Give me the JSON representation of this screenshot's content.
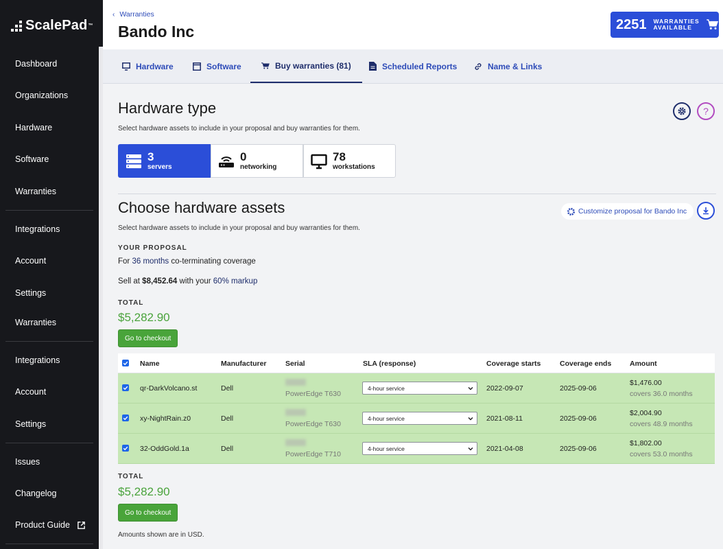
{
  "sidebar": {
    "logo": "ScalePad",
    "logo_tm": "™",
    "items": [
      {
        "label": "Dashboard"
      },
      {
        "label": "Organizations"
      },
      {
        "label": "Hardware"
      },
      {
        "label": "Software"
      },
      {
        "label": "Warranties"
      },
      {
        "label": "Integrations"
      },
      {
        "label": "Account"
      },
      {
        "label": "Settings"
      },
      {
        "label": "Warranties"
      },
      {
        "label": "Integrations"
      },
      {
        "label": "Account"
      },
      {
        "label": "Settings"
      },
      {
        "label": "Issues"
      },
      {
        "label": "Changelog"
      },
      {
        "label": "Product Guide"
      }
    ]
  },
  "header": {
    "breadcrumb": "Warranties",
    "title": "Bando Inc",
    "warranties_count": "2251",
    "warranties_label_1": "WARRANTIES",
    "warranties_label_2": "AVAILABLE"
  },
  "tabs": [
    {
      "label": "Hardware",
      "icon": "monitor-icon"
    },
    {
      "label": "Software",
      "icon": "window-icon"
    },
    {
      "label": "Buy warranties (81)",
      "icon": "cart-icon",
      "active": true
    },
    {
      "label": "Scheduled Reports",
      "icon": "document-icon"
    },
    {
      "label": "Name & Links",
      "icon": "link-icon"
    }
  ],
  "hardware_type": {
    "title": "Hardware type",
    "subtitle": "Select hardware assets to include in your proposal and buy warranties for them.",
    "cards": [
      {
        "count": "3",
        "label": "servers",
        "icon": "server-icon",
        "active": true
      },
      {
        "count": "0",
        "label": "networking",
        "icon": "router-icon"
      },
      {
        "count": "78",
        "label": "workstations",
        "icon": "monitor-icon"
      }
    ]
  },
  "assets": {
    "title": "Choose hardware assets",
    "subtitle": "Select hardware assets to include in your proposal and buy warranties for them.",
    "customize_label": "Customize proposal for Bando Inc",
    "proposal_label": "YOUR PROPOSAL",
    "coverage_prefix": "For",
    "coverage_months": "36 months",
    "coverage_mode": "co-terminating",
    "coverage_suffix": "coverage",
    "sell_prefix": "Sell at",
    "sell_amount": "$8,452.64",
    "sell_middle": "with your",
    "markup": "60% markup",
    "total_label": "TOTAL",
    "total_amount": "$5,282.90",
    "checkout_label": "Go to checkout",
    "footnote": "Amounts shown are in USD."
  },
  "table": {
    "headers": [
      "Name",
      "Manufacturer",
      "Serial",
      "SLA (response)",
      "Coverage starts",
      "Coverage ends",
      "Amount"
    ],
    "rows": [
      {
        "name": "qr-DarkVolcano.st",
        "manufacturer": "Dell",
        "model": "PowerEdge T630",
        "sla": "4-hour service",
        "start": "2022-09-07",
        "end": "2025-09-06",
        "amount": "$1,476.00",
        "covers": "covers 36.0 months"
      },
      {
        "name": "xy-NightRain.z0",
        "manufacturer": "Dell",
        "model": "PowerEdge T630",
        "sla": "4-hour service",
        "start": "2021-08-11",
        "end": "2025-09-06",
        "amount": "$2,004.90",
        "covers": "covers 48.9 months"
      },
      {
        "name": "32-OddGold.1a",
        "manufacturer": "Dell",
        "model": "PowerEdge T710",
        "sla": "4-hour service",
        "start": "2021-04-08",
        "end": "2025-09-06",
        "amount": "$1,802.00",
        "covers": "covers 53.0 months"
      }
    ]
  },
  "colors": {
    "sidebar_bg": "#17181c",
    "accent_blue": "#2b4ed8",
    "link_blue": "#2d4bb8",
    "green_total": "#4aa33c",
    "row_selected": "#c6e7b5"
  }
}
